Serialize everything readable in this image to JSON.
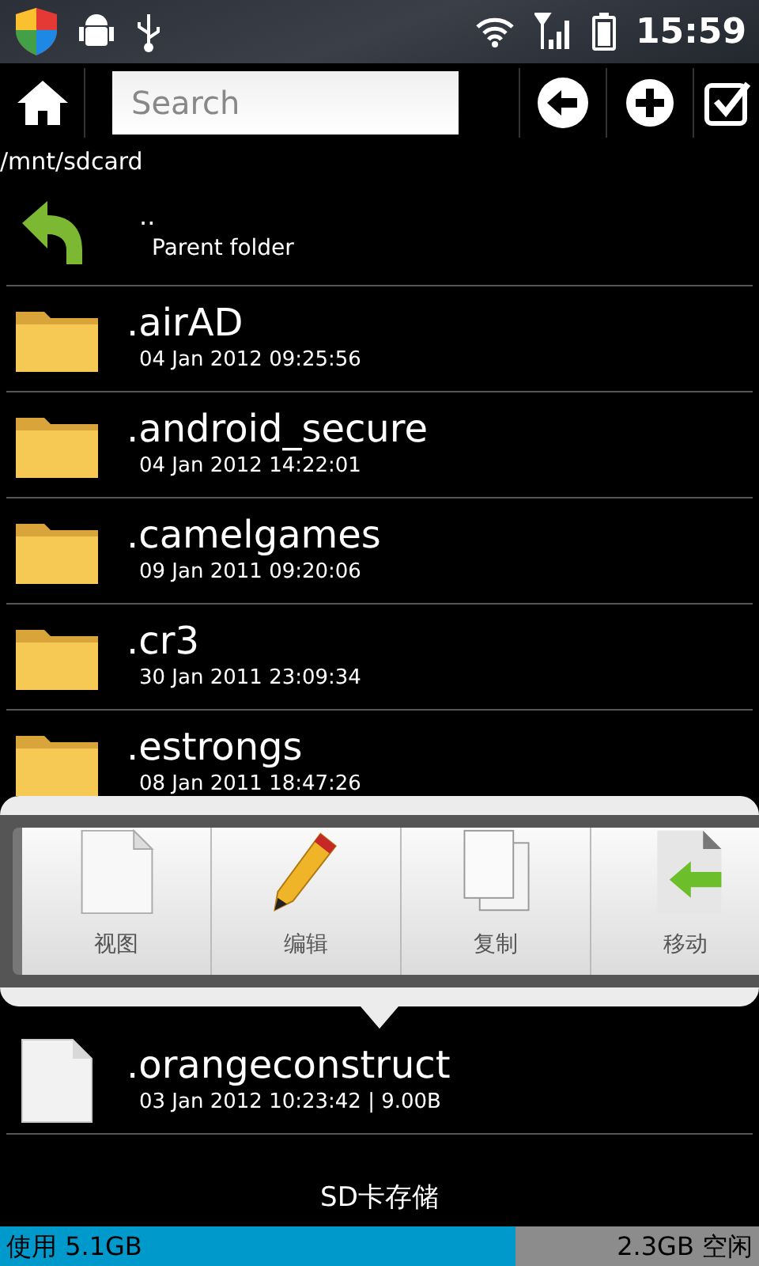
{
  "status_bar": {
    "time": "15:59"
  },
  "toolbar": {
    "search": {
      "placeholder": "Search"
    }
  },
  "path": "/mnt/sdcard",
  "parent": {
    "name": "..",
    "label": "Parent folder"
  },
  "files_above": [
    {
      "kind": "folder",
      "name": ".airAD",
      "meta": "04 Jan 2012 09:25:56"
    },
    {
      "kind": "folder",
      "name": ".android_secure",
      "meta": "04 Jan 2012 14:22:01"
    },
    {
      "kind": "folder",
      "name": ".camelgames",
      "meta": "09 Jan 2011 09:20:06"
    },
    {
      "kind": "folder",
      "name": ".cr3",
      "meta": "30 Jan 2011 23:09:34"
    },
    {
      "kind": "folder",
      "name": ".estrongs",
      "meta": "08 Jan 2011 18:47:26"
    }
  ],
  "files_below": [
    {
      "kind": "file",
      "name": ".orangeconstruct",
      "meta": "03 Jan 2012 10:23:42 | 9.00B"
    }
  ],
  "action_menu": [
    {
      "label": "视图"
    },
    {
      "label": "编辑"
    },
    {
      "label": "复制"
    },
    {
      "label": "移动"
    }
  ],
  "storage": {
    "title": "SD卡存储",
    "used": "使用 5.1GB",
    "free": "2.3GB 空闲",
    "level": 0.68
  }
}
